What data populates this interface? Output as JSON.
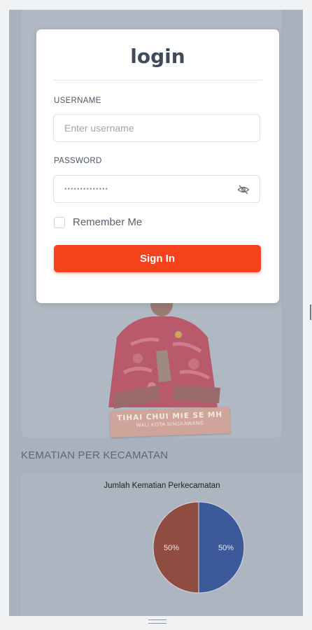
{
  "login": {
    "title": "login",
    "username_label": "USERNAME",
    "username_placeholder": "Enter username",
    "password_label": "PASSWORD",
    "password_value": "••••••••••••••",
    "remember_label": "Remember Me",
    "signin_label": "Sign In"
  },
  "hero": {
    "banner_name": "TIHAI CHUI MIE SE MH",
    "banner_sub": "WALI KOTA SINGKAWANG"
  },
  "section": {
    "title": "KEMATIAN PER KECAMATAN"
  },
  "chart_data": {
    "type": "pie",
    "title": "Jumlah Kematian Perkecamatan",
    "slices": [
      {
        "label": "50%",
        "value": 50,
        "color": "#3c5a9a"
      },
      {
        "label": "50%",
        "value": 50,
        "color": "#8f4c40"
      }
    ]
  },
  "colors": {
    "accent": "#f3421c",
    "overlay": "#a9b1bc"
  },
  "icons": {
    "password_toggle": "eye-off-icon"
  }
}
